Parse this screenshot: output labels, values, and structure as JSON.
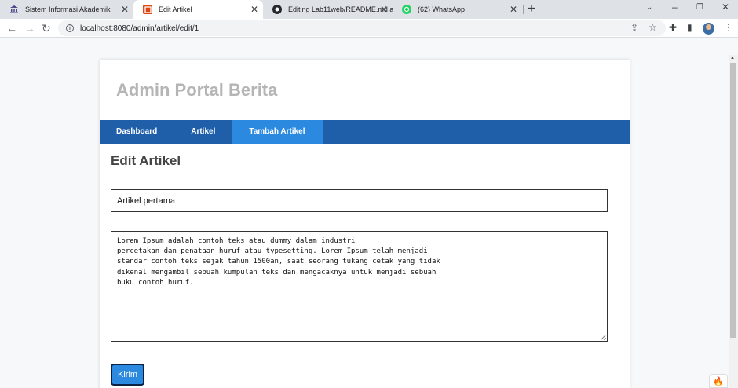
{
  "browser": {
    "tabs": [
      {
        "title": "Sistem Informasi Akademik",
        "icon": "university-icon",
        "active": false
      },
      {
        "title": "Edit Artikel",
        "icon": "codeigniter-icon",
        "active": true
      },
      {
        "title": "Editing Lab11web/README.md a",
        "icon": "github-icon",
        "active": false
      },
      {
        "title": "(62) WhatsApp",
        "icon": "whatsapp-icon",
        "active": false
      }
    ],
    "address": "localhost:8080/admin/artikel/edit/1"
  },
  "page": {
    "site_title": "Admin Portal Berita",
    "nav": [
      {
        "label": "Dashboard",
        "active": false
      },
      {
        "label": "Artikel",
        "active": false
      },
      {
        "label": "Tambah Artikel",
        "active": true
      }
    ],
    "heading": "Edit Artikel",
    "form": {
      "title_value": "Artikel pertama",
      "body_value": "Lorem Ipsum adalah contoh teks atau dummy dalam industri\npercetakan dan penataan huruf atau typesetting. Lorem Ipsum telah menjadi\nstandar contoh teks sejak tahun 1500an, saat seorang tukang cetak yang tidak\ndikenal mengambil sebuah kumpulan teks dan mengacaknya untuk menjadi sebuah\nbuku contoh huruf.",
      "submit_label": "Kirim"
    }
  },
  "colors": {
    "nav_bg": "#1f5faa",
    "nav_active": "#2b8ae0",
    "title_gray": "#b5b5b5"
  }
}
